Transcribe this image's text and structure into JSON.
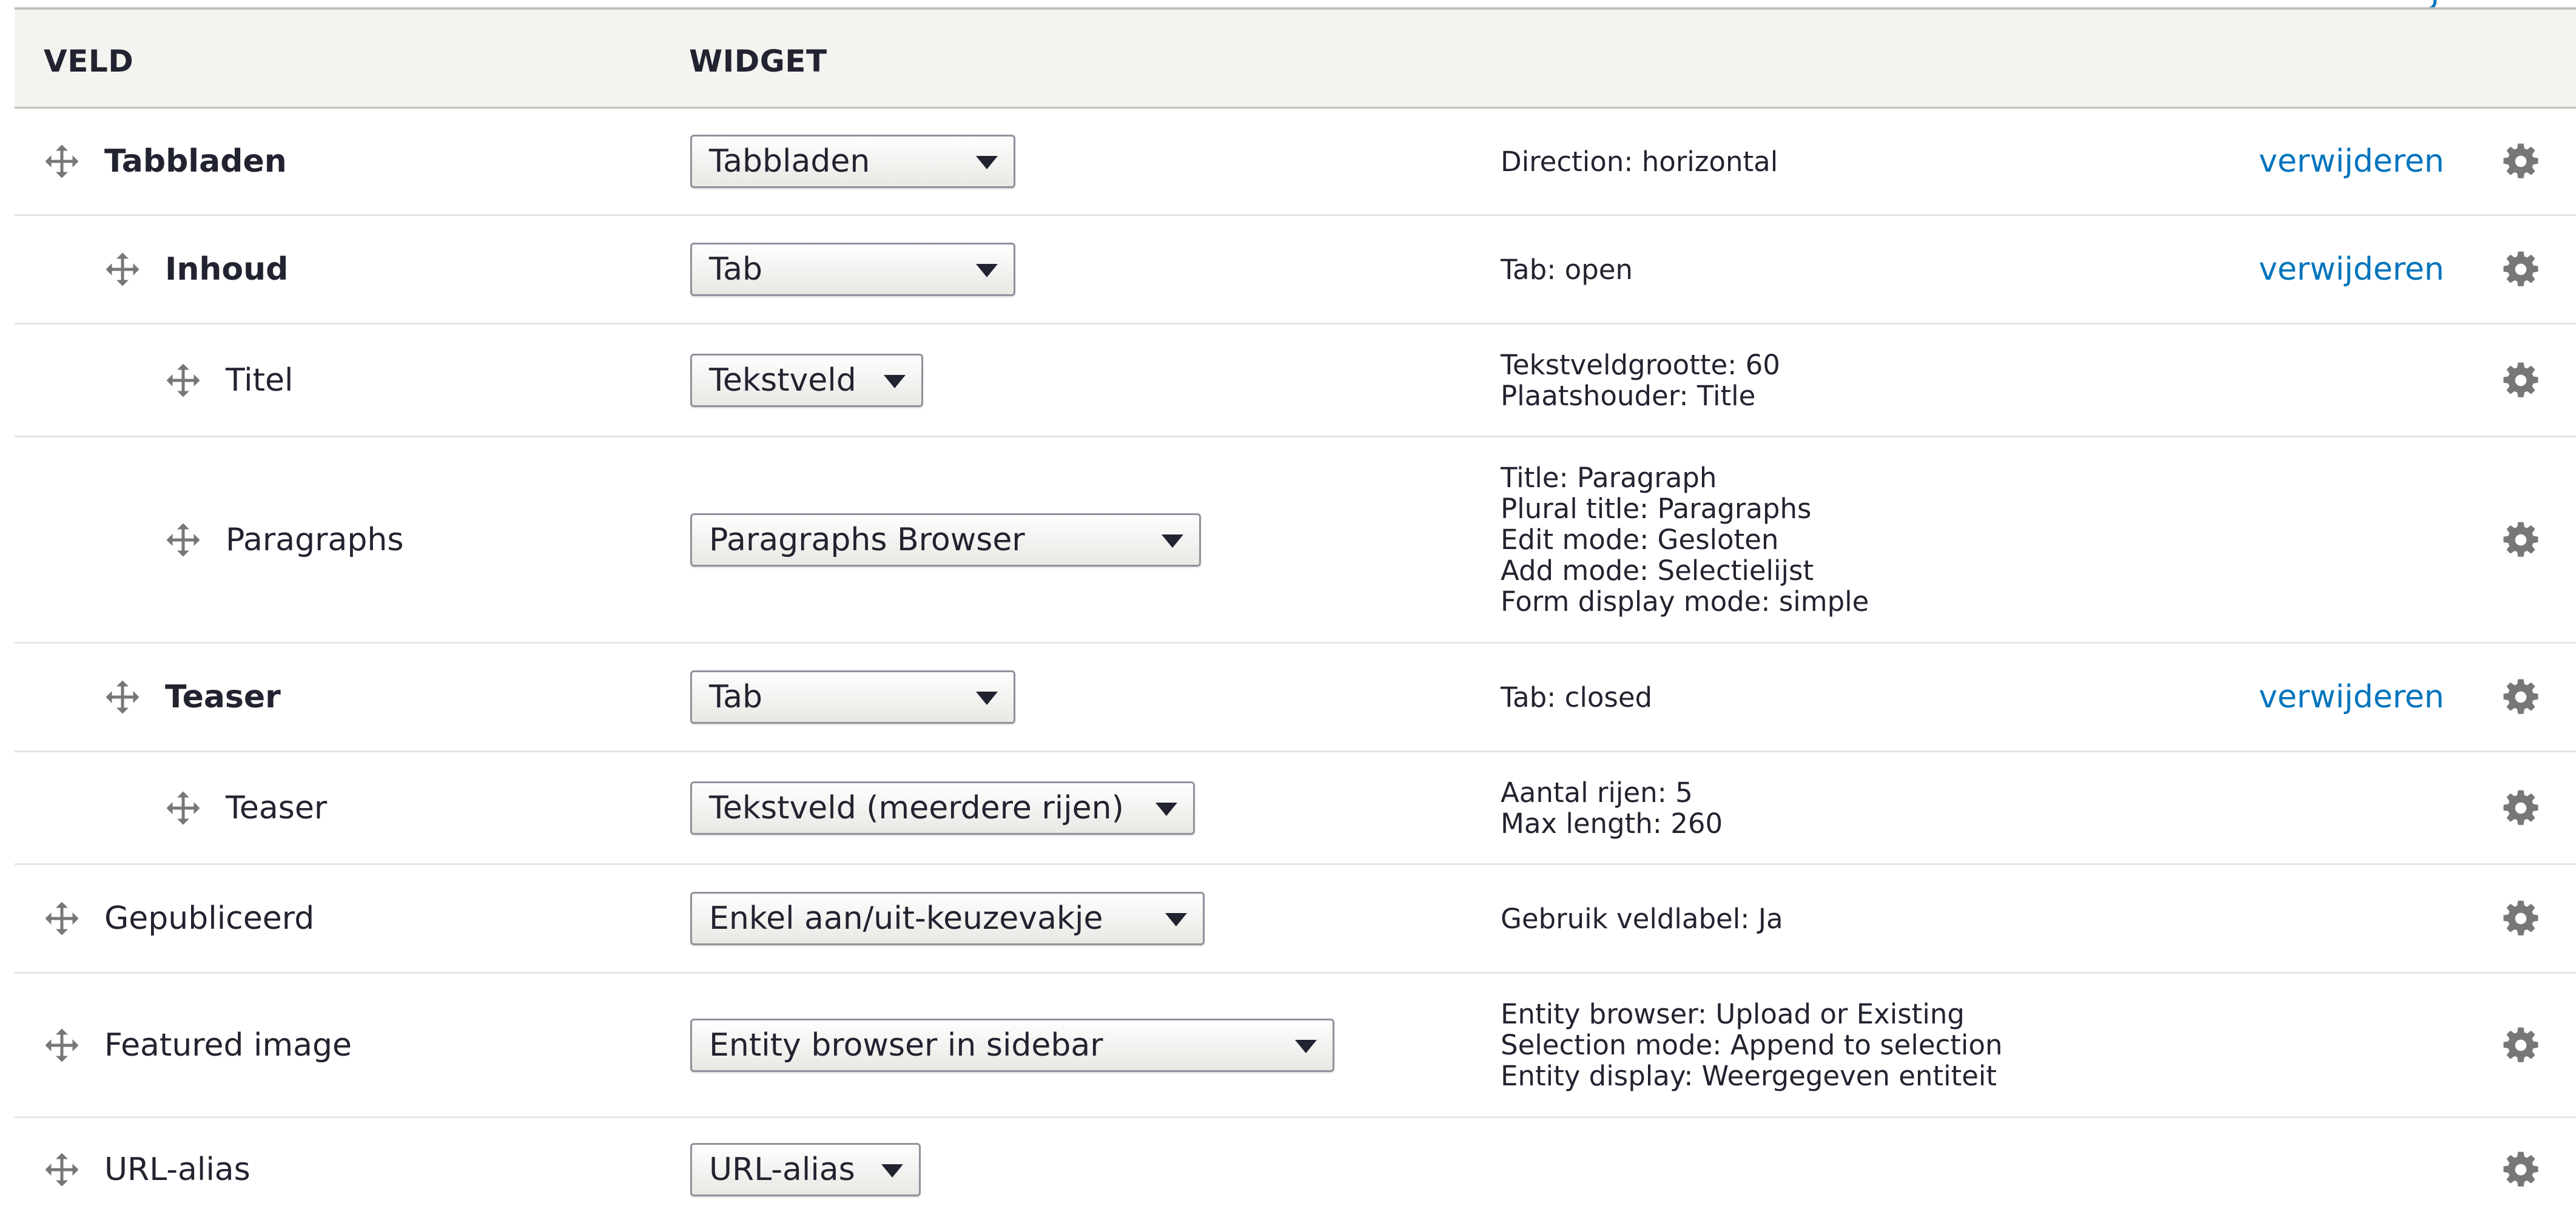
{
  "header": {
    "field_col": "VELD",
    "widget_col": "WIDGET"
  },
  "icons": {
    "drag": "move-arrows-icon",
    "settings": "gear-icon"
  },
  "colors": {
    "link": "#0074bd",
    "header_bg": "#f3f3f0",
    "icon": "#777777"
  },
  "rows": [
    {
      "name": "Tabbladen",
      "bold": true,
      "indent": 0,
      "widget": "Tabbladen",
      "summary": [
        "Direction: horizontal"
      ],
      "remove_label": "verwijderen"
    },
    {
      "name": "Inhoud",
      "bold": true,
      "indent": 1,
      "widget": "Tab",
      "summary": [
        "Tab: open"
      ],
      "remove_label": "verwijderen"
    },
    {
      "name": "Titel",
      "bold": false,
      "indent": 2,
      "widget": "Tekstveld",
      "summary": [
        "Tekstveldgrootte: 60",
        "Plaatshouder: Title"
      ],
      "remove_label": ""
    },
    {
      "name": "Paragraphs",
      "bold": false,
      "indent": 2,
      "widget": "Paragraphs Browser",
      "summary": [
        "Title: Paragraph",
        "Plural title: Paragraphs",
        "Edit mode: Gesloten",
        "Add mode: Selectielijst",
        "Form display mode: simple"
      ],
      "remove_label": ""
    },
    {
      "name": "Teaser",
      "bold": true,
      "indent": 1,
      "widget": "Tab",
      "summary": [
        "Tab: closed"
      ],
      "remove_label": "verwijderen"
    },
    {
      "name": "Teaser",
      "bold": false,
      "indent": 2,
      "widget": "Tekstveld (meerdere rijen)",
      "summary": [
        "Aantal rijen: 5",
        "Max length: 260"
      ],
      "remove_label": ""
    },
    {
      "name": "Gepubliceerd",
      "bold": false,
      "indent": 0,
      "widget": "Enkel aan/uit-keuzevakje",
      "summary": [
        "Gebruik veldlabel: Ja"
      ],
      "remove_label": ""
    },
    {
      "name": "Featured image",
      "bold": false,
      "indent": 0,
      "widget": "Entity browser in sidebar",
      "summary": [
        "Entity browser: Upload or Existing",
        "Selection mode: Append to selection",
        "Entity display: Weergegeven entiteit"
      ],
      "remove_label": ""
    },
    {
      "name": "URL-alias",
      "bold": false,
      "indent": 0,
      "widget": "URL-alias",
      "summary": [],
      "remove_label": ""
    }
  ]
}
